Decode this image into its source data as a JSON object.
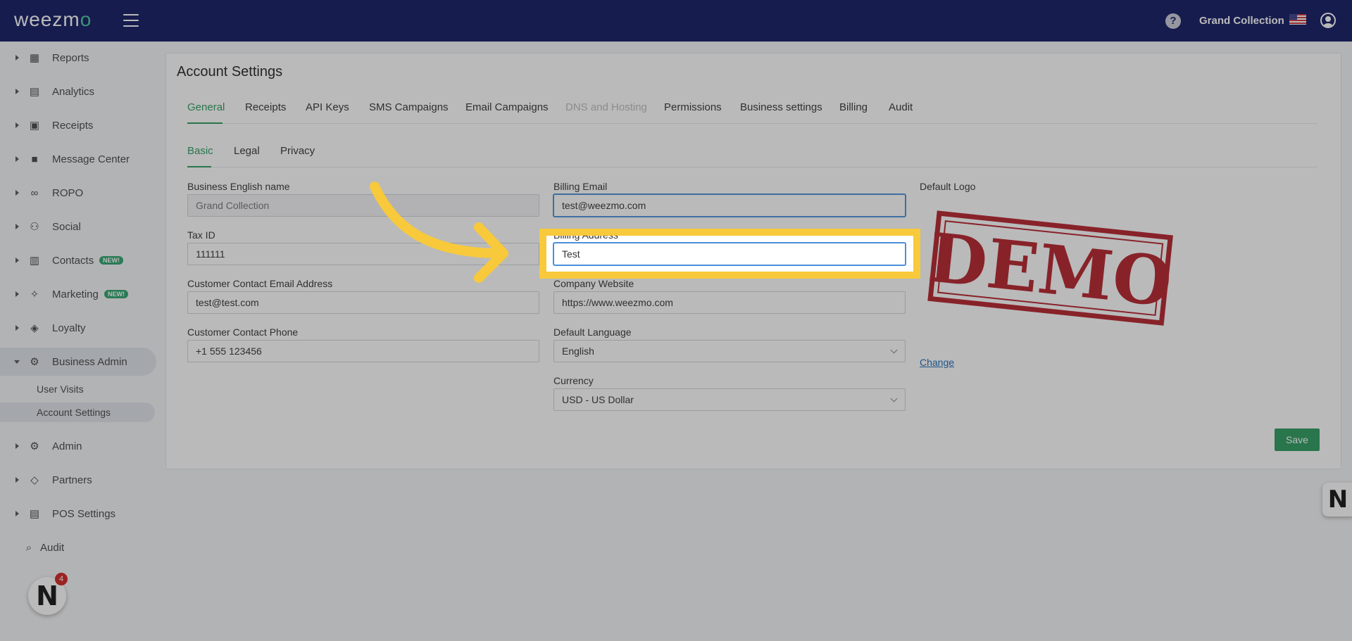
{
  "topbar": {
    "logo_text": "weezm",
    "logo_accent": "o",
    "help_icon": "?",
    "company": "Grand Collection",
    "brand_color": "#0e1760"
  },
  "sidebar": {
    "items": [
      {
        "label": "Reports",
        "icon": "dashboard-icon"
      },
      {
        "label": "Analytics",
        "icon": "chart-icon"
      },
      {
        "label": "Receipts",
        "icon": "receipt-icon"
      },
      {
        "label": "Message Center",
        "icon": "chat-icon"
      },
      {
        "label": "ROPO",
        "icon": "infinity-icon"
      },
      {
        "label": "Social",
        "icon": "people-icon"
      },
      {
        "label": "Contacts",
        "icon": "contacts-icon",
        "badge": "NEW!"
      },
      {
        "label": "Marketing",
        "icon": "megaphone-icon",
        "badge": "NEW!"
      },
      {
        "label": "Loyalty",
        "icon": "tag-icon"
      },
      {
        "label": "Business Admin",
        "icon": "gear-icon"
      },
      {
        "label": "Admin",
        "icon": "gears-icon"
      },
      {
        "label": "Partners",
        "icon": "handshake-icon"
      },
      {
        "label": "POS Settings",
        "icon": "printer-icon"
      },
      {
        "label": "Audit",
        "icon": "magnify-icon"
      }
    ],
    "sub_items": [
      "User Visits",
      "Account Settings"
    ],
    "chat_badge": "4",
    "chat_logo": "N"
  },
  "page": {
    "title": "Account Settings",
    "tabs": [
      "General",
      "Receipts",
      "API Keys",
      "SMS Campaigns",
      "Email Campaigns",
      "DNS and Hosting",
      "Permissions",
      "Business settings",
      "Billing",
      "Audit"
    ],
    "active_tab": "General",
    "disabled_tab": "DNS and Hosting",
    "subtabs": [
      "Basic",
      "Legal",
      "Privacy"
    ],
    "active_subtab": "Basic"
  },
  "form": {
    "business_name_label": "Business English name",
    "business_name_placeholder": "Grand Collection",
    "tax_id_label": "Tax ID",
    "tax_id_value": "111111",
    "contact_email_label": "Customer Contact Email Address",
    "contact_email_value": "test@test.com",
    "contact_phone_label": "Customer Contact Phone",
    "contact_phone_value": "+1 555 123456",
    "billing_email_label": "Billing Email",
    "billing_email_value": "test@weezmo.com",
    "billing_address_label": "Billing Address",
    "billing_address_value": "Test",
    "website_label": "Company Website",
    "website_value": "https://www.weezmo.com",
    "language_label": "Default Language",
    "language_value": "English",
    "currency_label": "Currency",
    "currency_value": "USD - US Dollar",
    "logo_label": "Default Logo",
    "logo_text": "DEMO",
    "change_link": "Change",
    "save_label": "Save"
  },
  "accent_color": "#2a9a5e",
  "highlight_color": "#f8c93a"
}
